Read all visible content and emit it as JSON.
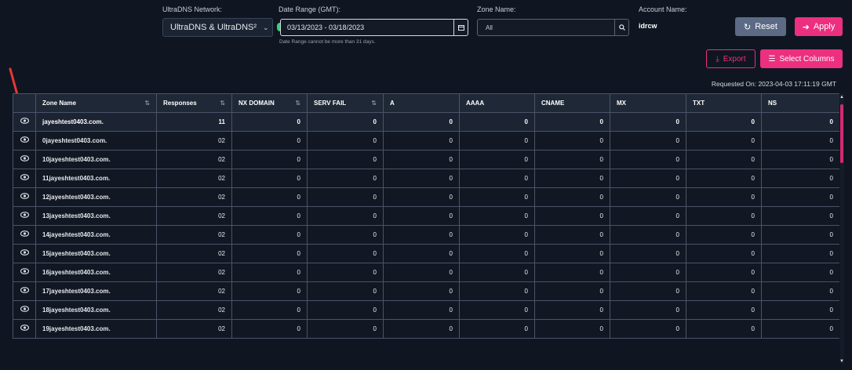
{
  "filters": {
    "network_label": "UltraDNS Network:",
    "network_value": "UltraDNS & UltraDNS²",
    "date_label": "Date Range (GMT):",
    "date_value": "03/13/2023 - 03/18/2023",
    "date_hint": "Date Range cannot be more than 31 days.",
    "zone_label": "Zone Name:",
    "zone_placeholder": "All",
    "account_label": "Account Name:",
    "account_value": "idrcw"
  },
  "buttons": {
    "reset": "Reset",
    "apply": "Apply",
    "export": "Export",
    "select_columns": "Select Columns"
  },
  "requested_on": "Requested On: 2023-04-03 17:11:19 GMT",
  "colors": {
    "accent": "#ec2f7f",
    "reset": "#5c6a85",
    "toggle": "#2fd67a"
  },
  "table": {
    "headers": [
      {
        "label": "Zone Name",
        "sortable": true
      },
      {
        "label": "Responses",
        "sortable": true
      },
      {
        "label": "NX DOMAIN",
        "sortable": true
      },
      {
        "label": "SERV FAIL",
        "sortable": true
      },
      {
        "label": "A",
        "sortable": false
      },
      {
        "label": "AAAA",
        "sortable": false
      },
      {
        "label": "CNAME",
        "sortable": false
      },
      {
        "label": "MX",
        "sortable": false
      },
      {
        "label": "TXT",
        "sortable": false
      },
      {
        "label": "NS",
        "sortable": false
      }
    ],
    "rows": [
      [
        "jayeshtest0403.com.",
        "11",
        "0",
        "0",
        "0",
        "0",
        "0",
        "0",
        "0",
        "0"
      ],
      [
        "0jayeshtest0403.com.",
        "02",
        "0",
        "0",
        "0",
        "0",
        "0",
        "0",
        "0",
        "0"
      ],
      [
        "10jayeshtest0403.com.",
        "02",
        "0",
        "0",
        "0",
        "0",
        "0",
        "0",
        "0",
        "0"
      ],
      [
        "11jayeshtest0403.com.",
        "02",
        "0",
        "0",
        "0",
        "0",
        "0",
        "0",
        "0",
        "0"
      ],
      [
        "12jayeshtest0403.com.",
        "02",
        "0",
        "0",
        "0",
        "0",
        "0",
        "0",
        "0",
        "0"
      ],
      [
        "13jayeshtest0403.com.",
        "02",
        "0",
        "0",
        "0",
        "0",
        "0",
        "0",
        "0",
        "0"
      ],
      [
        "14jayeshtest0403.com.",
        "02",
        "0",
        "0",
        "0",
        "0",
        "0",
        "0",
        "0",
        "0"
      ],
      [
        "15jayeshtest0403.com.",
        "02",
        "0",
        "0",
        "0",
        "0",
        "0",
        "0",
        "0",
        "0"
      ],
      [
        "16jayeshtest0403.com.",
        "02",
        "0",
        "0",
        "0",
        "0",
        "0",
        "0",
        "0",
        "0"
      ],
      [
        "17jayeshtest0403.com.",
        "02",
        "0",
        "0",
        "0",
        "0",
        "0",
        "0",
        "0",
        "0"
      ],
      [
        "18jayeshtest0403.com.",
        "02",
        "0",
        "0",
        "0",
        "0",
        "0",
        "0",
        "0",
        "0"
      ],
      [
        "19jayeshtest0403.com.",
        "02",
        "0",
        "0",
        "0",
        "0",
        "0",
        "0",
        "0",
        "0"
      ]
    ]
  }
}
